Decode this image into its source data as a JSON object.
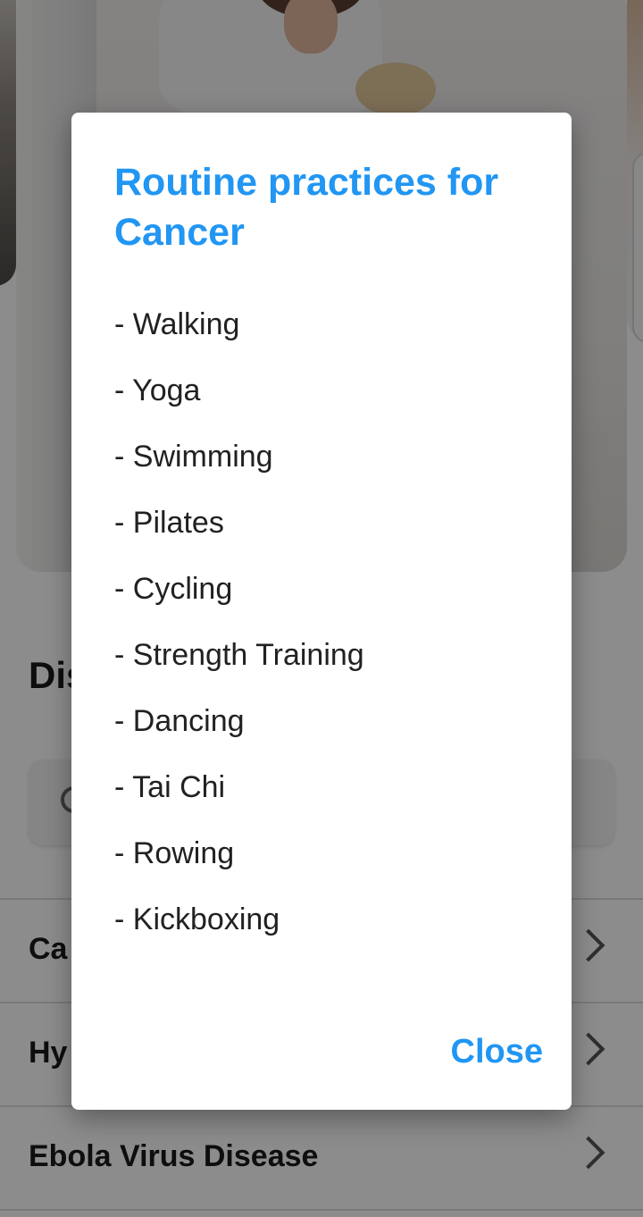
{
  "background": {
    "section_title": "Dis",
    "diseases": [
      {
        "label": "Ca"
      },
      {
        "label": "Hy"
      },
      {
        "label": "Ebola Virus Disease"
      }
    ]
  },
  "dialog": {
    "title": "Routine practices for Cancer",
    "items": [
      "- Walking",
      "- Yoga",
      "- Swimming",
      "- Pilates",
      "- Cycling",
      "- Strength Training",
      "- Dancing",
      "- Tai Chi",
      "- Rowing",
      "- Kickboxing"
    ],
    "close_label": "Close"
  },
  "colors": {
    "accent": "#2196f3",
    "scrim": "rgba(0,0,0,0.45)"
  }
}
